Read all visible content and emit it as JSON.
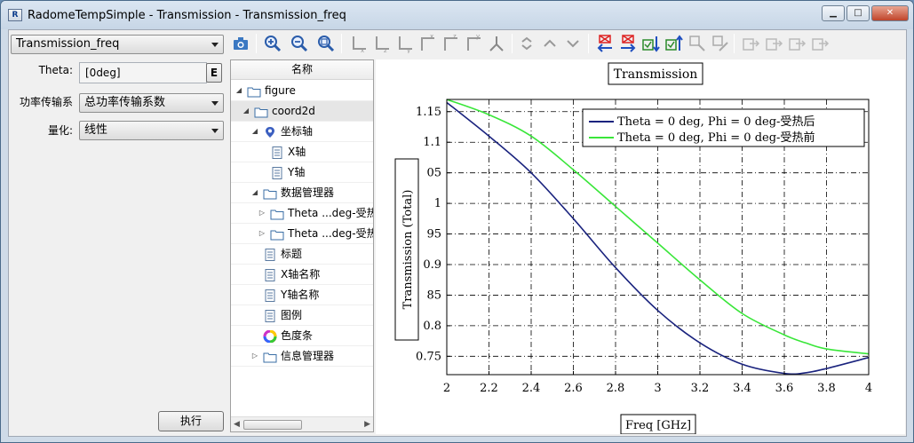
{
  "window": {
    "title": "RadomeTempSimple - Transmission - Transmission_freq",
    "minimize_glyph": "▁",
    "maximize_glyph": "□",
    "close_glyph": "✕"
  },
  "left_panel": {
    "result_select": "Transmission_freq",
    "theta_label": "Theta:",
    "theta_value": "[0deg]",
    "expr_button": "E",
    "power_label": "功率传输系",
    "power_value": "总功率传输系数",
    "quant_label": "量化:",
    "quant_value": "线性",
    "execute_button": "执行"
  },
  "tree": {
    "header": "名称",
    "items": [
      {
        "label": "figure",
        "icon": "folder-icon"
      },
      {
        "label": "coord2d",
        "icon": "folder-icon"
      },
      {
        "label": "坐标轴",
        "icon": "pin-icon"
      },
      {
        "label": "X轴",
        "icon": "document-icon"
      },
      {
        "label": "Y轴",
        "icon": "document-icon"
      },
      {
        "label": "数据管理器",
        "icon": "folder-icon"
      },
      {
        "label": "Theta ...deg-受热",
        "icon": "folder-icon"
      },
      {
        "label": "Theta ...deg-受热",
        "icon": "folder-icon"
      },
      {
        "label": "标题",
        "icon": "document-icon"
      },
      {
        "label": "X轴名称",
        "icon": "document-icon"
      },
      {
        "label": "Y轴名称",
        "icon": "document-icon"
      },
      {
        "label": "图例",
        "icon": "document-icon"
      },
      {
        "label": "色度条",
        "icon": "colorwheel-icon"
      },
      {
        "label": "信息管理器",
        "icon": "folder-icon"
      }
    ]
  },
  "toolbar": {
    "icons": [
      "camera-icon",
      "zoom-in-icon",
      "zoom-out-icon",
      "zoom-fit-icon",
      "axis-x-icon",
      "axis-z-icon",
      "axis-y-icon",
      "axis-x2-icon",
      "axis-z2-icon",
      "axis-y2-icon",
      "axis-3d-icon",
      "arrow-up-down-icon",
      "arrow-up-icon",
      "arrow-down-icon",
      "marker-left-icon",
      "marker-right-icon",
      "marker-down-icon",
      "marker-up-icon",
      "marker-a-icon",
      "marker-b-icon",
      "export-icon",
      "export2-icon",
      "export3-icon",
      "export4-icon"
    ]
  },
  "chart_data": {
    "type": "line",
    "title": "Transmission",
    "xlabel": "Freq [GHz]",
    "ylabel": "Transmission (Total)",
    "xlim": [
      2,
      4
    ],
    "ylim": [
      0.72,
      1.17
    ],
    "xticks": [
      "2",
      "2.2",
      "2.4",
      "2.6",
      "2.8",
      "3",
      "3.2",
      "3.4",
      "3.6",
      "3.8",
      "4"
    ],
    "yticks": [
      "0.75",
      "0.8",
      "0.85",
      "0.9",
      "0.95",
      "1",
      "1.05",
      "1.1",
      "1.15"
    ],
    "yticks_shown": [
      "0.75",
      "0.8",
      "85",
      "0.9",
      "95",
      "1",
      "05",
      "1.1",
      "1.15"
    ],
    "grid": true,
    "legend_position": "top-right",
    "x": [
      2.0,
      2.2,
      2.4,
      2.6,
      2.8,
      3.0,
      3.2,
      3.4,
      3.6,
      3.7,
      3.8,
      4.0
    ],
    "series": [
      {
        "name": "Theta = 0 deg, Phi = 0 deg-受热后",
        "color": "#1a237e",
        "values": [
          1.165,
          1.11,
          1.05,
          0.975,
          0.895,
          0.825,
          0.772,
          0.737,
          0.722,
          0.723,
          0.73,
          0.748
        ]
      },
      {
        "name": "Theta = 0 deg, Phi = 0 deg-受热前",
        "color": "#39e639",
        "values": [
          1.17,
          1.145,
          1.11,
          1.055,
          0.995,
          0.935,
          0.875,
          0.82,
          0.785,
          0.772,
          0.762,
          0.754
        ]
      }
    ]
  }
}
